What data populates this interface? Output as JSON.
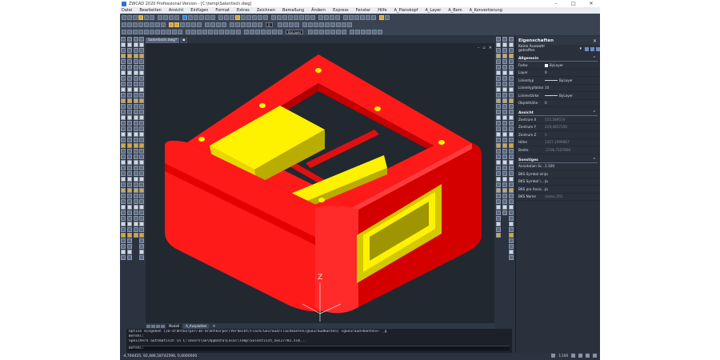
{
  "window": {
    "title": "ZWCAD 2020 Professional Version - [C:\\temp\\Salontisch.dwg]",
    "controls": [
      "–",
      "□",
      "✕"
    ]
  },
  "menu": [
    "Datei",
    "Bearbeiten",
    "Ansicht",
    "Einfügen",
    "Format",
    "Extras",
    "Zeichnen",
    "Bemaßung",
    "Ändern",
    "Express",
    "Fenster",
    "Hilfe",
    "A_Planskopf",
    "A_Layer",
    "A_Bem",
    "A_Konvertierung"
  ],
  "toolbar": {
    "layer_combo": "0",
    "linetype_combo": "ByLayer"
  },
  "document_tab": "Salontisch.dwg*",
  "layout_tabs": [
    "Modell",
    "A_Ausplotten"
  ],
  "command_lines": [
    "Option eingeben [2D-drahtkörper/3D-drahtkörper/Verdeckt/Flach/Gouraud/Flachkanten/gGouraudKanten] <gGouraud+Kanten>: _g",
    "Befehl:",
    "Speichern automatisch in C:\\Users\\ae\\AppData\\Local\\Temp\\Salontisch_zws27781.sv$...",
    "Befehl:"
  ],
  "status": {
    "coords": "-4,704425, 92,486,58742596, 0,0000000",
    "scale": "1:100"
  },
  "viewport": {
    "axis_label": "Z",
    "colors": {
      "frame": "#ff1a1a",
      "frame_shade": "#b30000",
      "frame_dark": "#7a0000",
      "inner": "#fff200",
      "inner_shade": "#b8ad00",
      "bg": "#212830"
    }
  },
  "properties": {
    "title": "Eigenschaften",
    "selection": "Keine Auswahl getroffen",
    "sections": [
      {
        "title": "Allgemein",
        "rows": [
          {
            "key": "Farbe",
            "value": "ByLayer",
            "kind": "color"
          },
          {
            "key": "Layer",
            "value": "0"
          },
          {
            "key": "Linientyp",
            "value": "ByLayer",
            "kind": "line"
          },
          {
            "key": "Linientypfaktor",
            "value": "10"
          },
          {
            "key": "Linienstärke",
            "value": "ByLayer",
            "kind": "line"
          },
          {
            "key": "Objekthöhe",
            "value": "0"
          }
        ]
      },
      {
        "title": "Ansicht",
        "rows": [
          {
            "key": "Zentrum X",
            "value": "515,589574",
            "dim": true
          },
          {
            "key": "Zentrum Y",
            "value": "219,4657150",
            "dim": true
          },
          {
            "key": "Zentrum Z",
            "value": "0",
            "dim": true
          },
          {
            "key": "Höhe",
            "value": "1327,1099887",
            "dim": true
          },
          {
            "key": "Breite",
            "value": "-2706,7107866",
            "dim": true
          }
        ]
      },
      {
        "title": "Sonstiges",
        "rows": [
          {
            "key": "Annotation Sc...",
            "value": "1:100"
          },
          {
            "key": "BKS Symbol ein",
            "value": "Ja"
          },
          {
            "key": "BKS Symbol i...",
            "value": "Ja"
          },
          {
            "key": "BKS pro Ansic...",
            "value": "Ja"
          },
          {
            "key": "BKS Name",
            "value": "anzeo_001",
            "dim": true
          }
        ]
      }
    ]
  }
}
